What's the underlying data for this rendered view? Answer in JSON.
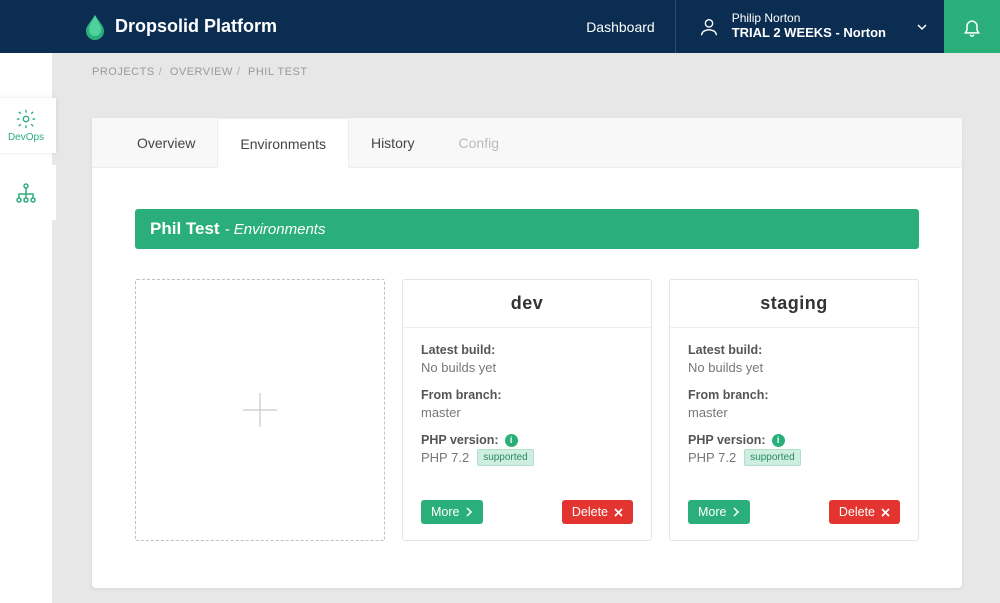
{
  "header": {
    "brand": "Dropsolid Platform",
    "dashboard": "Dashboard",
    "profile_name": "Philip Norton",
    "profile_org": "TRIAL 2 WEEKS - Norton"
  },
  "sidenav": {
    "devops": "DevOps"
  },
  "breadcrumbs": {
    "a": "PROJECTS",
    "b": "OVERVIEW",
    "c": "PHIL TEST"
  },
  "tabs": {
    "overview": "Overview",
    "environments": "Environments",
    "history": "History",
    "config": "Config"
  },
  "titlebar": {
    "name": "Phil Test",
    "sub": "- Environments"
  },
  "labels": {
    "latest_build": "Latest build:",
    "from_branch": "From branch:",
    "php_version": "PHP version:",
    "more": "More",
    "delete": "Delete",
    "supported": "supported"
  },
  "envs": {
    "e1": {
      "name": "dev",
      "build": "No builds yet",
      "branch": "master",
      "php": "PHP 7.2"
    },
    "e2": {
      "name": "staging",
      "build": "No builds yet",
      "branch": "master",
      "php": "PHP 7.2"
    }
  }
}
